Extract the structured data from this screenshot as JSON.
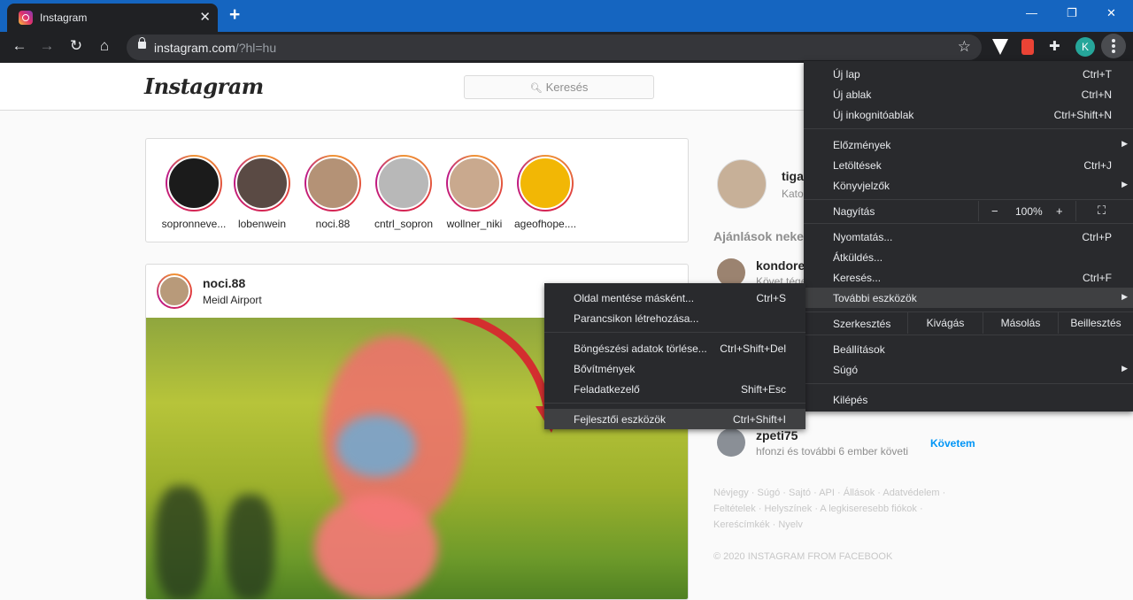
{
  "browser": {
    "tab_title": "Instagram",
    "tab_close": "✕",
    "new_tab": "+",
    "window": {
      "minimize": "—",
      "maximize": "❐",
      "close": "✕"
    },
    "url_host": "instagram.com",
    "url_path": "/?hl=hu",
    "profile_initial": "K"
  },
  "instagram": {
    "logo": "Instagram",
    "search_placeholder": "Keresés",
    "stories": [
      {
        "name": "sopronneve...",
        "color": "#1b1b1b"
      },
      {
        "name": "lobenwein",
        "color": "#5a4a44"
      },
      {
        "name": "noci.88",
        "color": "#b49276"
      },
      {
        "name": "cntrl_sopron",
        "color": "#b8b8b8"
      },
      {
        "name": "wollner_niki",
        "color": "#c9a98e"
      },
      {
        "name": "ageofhope....",
        "color": "#f2b705"
      }
    ],
    "post": {
      "user": "noci.88",
      "location": "Meidl Airport"
    },
    "sidebar": {
      "user": "tiga",
      "sub": "Kato",
      "suggestions_title": "Ajánlások neked",
      "suggestions": [
        {
          "name": "kondore",
          "sub": "Követ téged"
        },
        {
          "name": "zpeti75",
          "sub": "hfonzi és további 6 ember követi",
          "action": "Követem"
        }
      ],
      "footer_links": "Névjegy · Súgó · Sajtó · API · Állások · Adatvédelem · Feltételek · Helyszínek · A legkiseresebb fiókok · Kereścímkék · Nyelv",
      "copyright": "© 2020 INSTAGRAM FROM FACEBOOK"
    }
  },
  "menu": {
    "new_tab": {
      "label": "Új lap",
      "shortcut": "Ctrl+T"
    },
    "new_window": {
      "label": "Új ablak",
      "shortcut": "Ctrl+N"
    },
    "incognito": {
      "label": "Új inkognitóablak",
      "shortcut": "Ctrl+Shift+N"
    },
    "history": {
      "label": "Előzmények"
    },
    "downloads": {
      "label": "Letöltések",
      "shortcut": "Ctrl+J"
    },
    "bookmarks": {
      "label": "Könyvjelzők"
    },
    "zoom": {
      "label": "Nagyítás",
      "minus": "−",
      "value": "100%",
      "plus": "+"
    },
    "print": {
      "label": "Nyomtatás...",
      "shortcut": "Ctrl+P"
    },
    "cast": {
      "label": "Átküldés..."
    },
    "find": {
      "label": "Keresés...",
      "shortcut": "Ctrl+F"
    },
    "more_tools": {
      "label": "További eszközök"
    },
    "edit": {
      "label": "Szerkesztés",
      "cut": "Kivágás",
      "copy": "Másolás",
      "paste": "Beillesztés"
    },
    "settings": {
      "label": "Beállítások"
    },
    "help": {
      "label": "Súgó"
    },
    "exit": {
      "label": "Kilépés"
    }
  },
  "submenu": {
    "save_page": {
      "label": "Oldal mentése másként...",
      "shortcut": "Ctrl+S"
    },
    "create_shortcut": {
      "label": "Parancsikon létrehozása..."
    },
    "clear_data": {
      "label": "Böngészési adatok törlése...",
      "shortcut": "Ctrl+Shift+Del"
    },
    "extensions": {
      "label": "Bővítmények"
    },
    "task_manager": {
      "label": "Feladatkezelő",
      "shortcut": "Shift+Esc"
    },
    "devtools": {
      "label": "Fejlesztői eszközök",
      "shortcut": "Ctrl+Shift+I"
    }
  }
}
